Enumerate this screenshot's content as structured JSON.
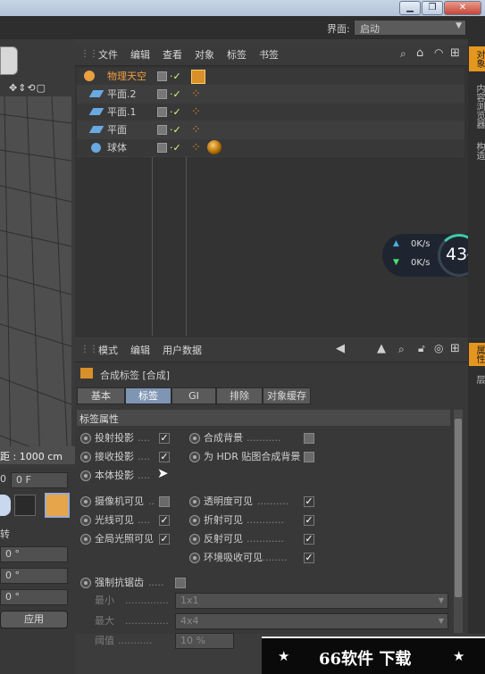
{
  "window": {
    "minimize": "▁",
    "restore": "❐",
    "close": "✕"
  },
  "layout": {
    "label": "界面:",
    "value": "启动"
  },
  "object_manager": {
    "menu": [
      "文件",
      "编辑",
      "查看",
      "对象",
      "标签",
      "书签"
    ],
    "objects": [
      {
        "name": "物理天空",
        "highlight": true,
        "tag": "clapper"
      },
      {
        "name": "平面.2",
        "highlight": false,
        "tag": "dots"
      },
      {
        "name": "平面.1",
        "highlight": false,
        "tag": "dots"
      },
      {
        "name": "平面",
        "highlight": false,
        "tag": "dots"
      },
      {
        "name": "球体",
        "highlight": false,
        "tag": "dots-ball"
      }
    ]
  },
  "net_widget": {
    "up": "0K/s",
    "down": "0K/s",
    "percent": "43",
    "percent_unit": "%"
  },
  "right_tabs_top": [
    "对象",
    "内容浏览器",
    "构造"
  ],
  "right_tabs_bottom": [
    "属性",
    "层"
  ],
  "attribute_manager": {
    "menu": [
      "模式",
      "编辑",
      "用户数据"
    ],
    "title": "合成标签 [合成]",
    "tabs": [
      {
        "label": "基本",
        "active": false
      },
      {
        "label": "标签",
        "active": true
      },
      {
        "label": "GI",
        "active": false
      },
      {
        "label": "排除",
        "active": false
      },
      {
        "label": "对象缓存",
        "active": false
      }
    ],
    "section": "标签属性",
    "left_props": [
      {
        "label": "投射投影",
        "dots": "....",
        "checked": true
      },
      {
        "label": "接收投影",
        "dots": "....",
        "checked": true
      },
      {
        "label": "本体投影",
        "dots": "....",
        "checked": false
      }
    ],
    "right_props": [
      {
        "label": "合成背景",
        "dots": "...........",
        "checked": false
      },
      {
        "label": "为 HDR 贴图合成背景",
        "dots": "",
        "checked": false
      }
    ],
    "left_props2": [
      {
        "label": "摄像机可见",
        "dots": "..",
        "checked": false
      },
      {
        "label": "光线可见",
        "dots": "....",
        "checked": true
      },
      {
        "label": "全局光照可见",
        "dots": "",
        "checked": true
      }
    ],
    "right_props2": [
      {
        "label": "透明度可见",
        "dots": "..........",
        "checked": true
      },
      {
        "label": "折射可见",
        "dots": "............",
        "checked": true
      },
      {
        "label": "反射可见",
        "dots": "............",
        "checked": true
      },
      {
        "label": "环境吸收可见",
        "dots": ".........",
        "checked": true
      }
    ],
    "antialias": {
      "label": "强制抗锯齿",
      "dots": ".....",
      "min_label": "最小",
      "min_value": "1x1",
      "max_label": "最大",
      "max_value": "4x4",
      "threshold_label": "阈值",
      "threshold_value": "10 %"
    }
  },
  "left_panel": {
    "distance": "距 : 1000 cm",
    "frame": "0 F",
    "frame_prefix": "0",
    "rotate_label": "转",
    "fields": [
      "0 °",
      "0 °",
      "0 °"
    ],
    "apply": "应用"
  },
  "watermark": {
    "text": "66软件 下载",
    "star": "★"
  }
}
